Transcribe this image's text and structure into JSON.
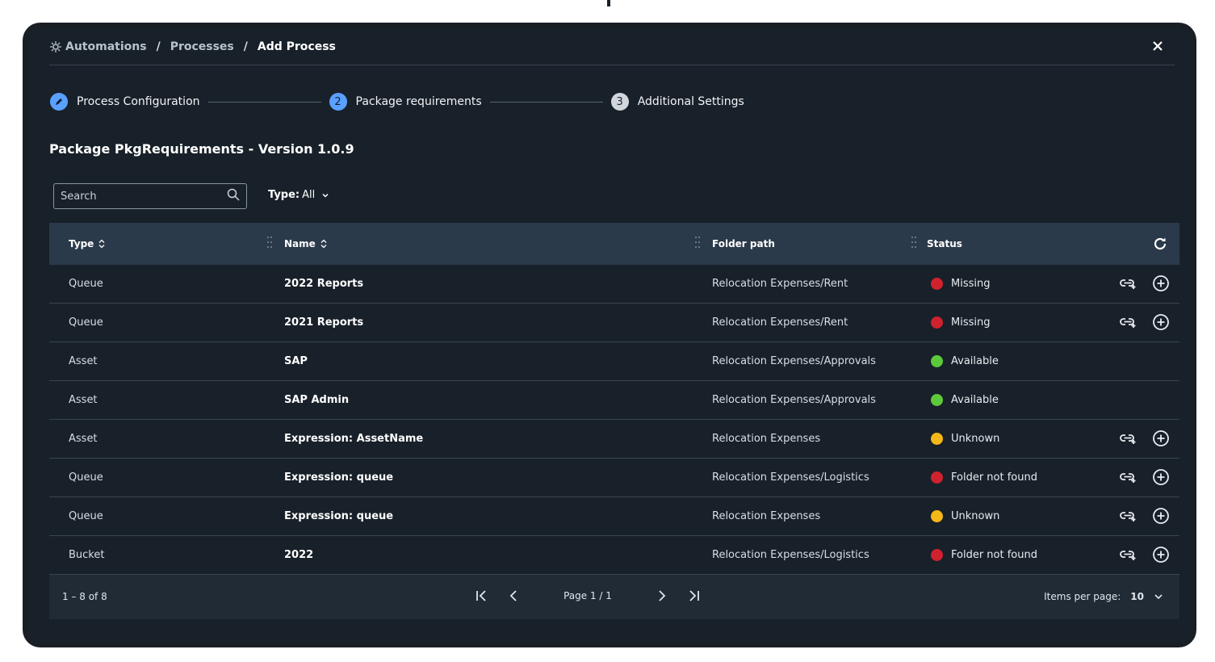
{
  "breadcrumb": {
    "items": [
      "Automations",
      "Processes",
      "Add Process"
    ],
    "separator": "/"
  },
  "stepper": {
    "steps": [
      {
        "number": "",
        "label": "Process Configuration",
        "state": "done"
      },
      {
        "number": "2",
        "label": "Package requirements",
        "state": "current"
      },
      {
        "number": "3",
        "label": "Additional Settings",
        "state": "pending"
      }
    ]
  },
  "package_title": "Package PkgRequirements - Version 1.0.9",
  "search": {
    "placeholder": "Search",
    "value": ""
  },
  "type_filter": {
    "label": "Type:",
    "value": "All"
  },
  "table": {
    "columns": [
      "Type",
      "Name",
      "Folder path",
      "Status"
    ],
    "rows": [
      {
        "type": "Queue",
        "name": "2022 Reports",
        "folder": "Relocation Expenses/Rent",
        "status": "Missing",
        "status_color": "#d0212e",
        "actions": true
      },
      {
        "type": "Queue",
        "name": "2021 Reports",
        "folder": "Relocation Expenses/Rent",
        "status": "Missing",
        "status_color": "#d0212e",
        "actions": true
      },
      {
        "type": "Asset",
        "name": "SAP",
        "folder": "Relocation Expenses/Approvals",
        "status": "Available",
        "status_color": "#5cc93a",
        "actions": false
      },
      {
        "type": "Asset",
        "name": "SAP Admin",
        "folder": "Relocation Expenses/Approvals",
        "status": "Available",
        "status_color": "#5cc93a",
        "actions": false
      },
      {
        "type": "Asset",
        "name": "Expression: AssetName",
        "folder": "Relocation Expenses",
        "status": "Unknown",
        "status_color": "#f5b819",
        "actions": true
      },
      {
        "type": "Queue",
        "name": "Expression: queue",
        "folder": "Relocation Expenses/Logistics",
        "status": "Folder not found",
        "status_color": "#d0212e",
        "actions": true
      },
      {
        "type": "Queue",
        "name": "Expression: queue",
        "folder": "Relocation Expenses",
        "status": "Unknown",
        "status_color": "#f5b819",
        "actions": true
      },
      {
        "type": "Bucket",
        "name": "2022",
        "folder": "Relocation Expenses/Logistics",
        "status": "Folder not found",
        "status_color": "#d0212e",
        "actions": true
      }
    ]
  },
  "pagination": {
    "range": "1 – 8 of 8",
    "page": "Page 1 / 1",
    "items_per_page_label": "Items per page:",
    "items_per_page_value": "10"
  },
  "colors": {
    "accent": "#5aa0ff",
    "background": "#182029",
    "header": "#2b3a4a"
  },
  "icons": [
    "automations-icon",
    "close-icon",
    "pencil-icon",
    "search-icon",
    "chevron-down-icon",
    "sort-icon",
    "drag-handle-icon",
    "refresh-icon",
    "link-add-icon",
    "add-circle-icon",
    "first-page-icon",
    "prev-page-icon",
    "next-page-icon",
    "last-page-icon"
  ]
}
